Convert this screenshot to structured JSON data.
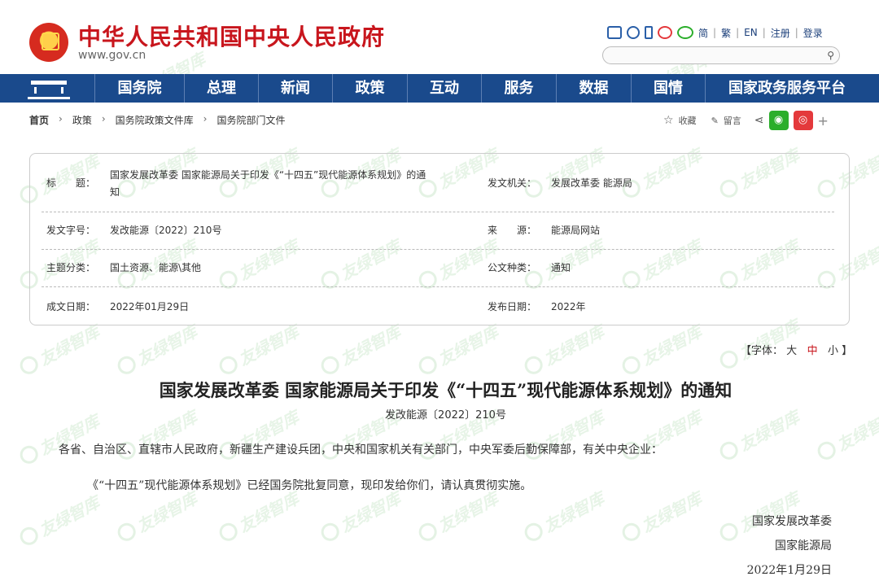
{
  "header": {
    "site_title": "中华人民共和国中央人民政府",
    "site_url": "www.gov.cn",
    "lang_links": [
      "简",
      "繁",
      "EN",
      "注册",
      "登录"
    ],
    "icons": [
      "mail-icon",
      "list-icon",
      "phone-icon",
      "weibo-icon",
      "wechat-icon"
    ]
  },
  "nav": {
    "items": [
      "国务院",
      "总理",
      "新闻",
      "政策",
      "互动",
      "服务",
      "数据",
      "国情",
      "国家政务服务平台"
    ]
  },
  "breadcrumb": [
    "首页",
    "政策",
    "国务院政策文件库",
    "国务院部门文件"
  ],
  "actions": {
    "favorite": "收藏",
    "comment": "留言",
    "plus": "+"
  },
  "info": {
    "title_label": "标　　题：",
    "title_value_line1": "国家发展改革委 国家能源局关于印发《“十四五”现代能源体系规划》的通",
    "title_value_line2": "知",
    "issuer_label": "发文机关：",
    "issuer_value": "发展改革委 能源局",
    "docno_label": "发文字号：",
    "docno_value": "发改能源〔2022〕210号",
    "source_label": "来　　源：",
    "source_value": "能源局网站",
    "topic_label": "主题分类：",
    "topic_value": "国土资源、能源\\其他",
    "type_label": "公文种类：",
    "type_value": "通知",
    "written_label": "成文日期：",
    "written_value": "2022年01月29日",
    "published_label": "发布日期：",
    "published_value": "2022年"
  },
  "fontbar": {
    "prefix": "【字体：",
    "large": "大",
    "medium": "中",
    "small": "小",
    "suffix": "】"
  },
  "article": {
    "title": "国家发展改革委 国家能源局关于印发《“十四五”现代能源体系规划》的通知",
    "doc_no": "发改能源〔2022〕210号",
    "para1": "各省、自治区、直辖市人民政府，新疆生产建设兵团，中央和国家机关有关部门，中央军委后勤保障部，有关中央企业：",
    "para2": "《“十四五”现代能源体系规划》已经国务院批复同意，现印发给你们，请认真贯彻实施。",
    "sign1": "国家发展改革委",
    "sign2": "国家能源局",
    "date": "2022年1月29日"
  },
  "watermark": "友绿智库",
  "colors": {
    "brand_red": "#c8161d",
    "nav_blue": "#1a4a8c"
  }
}
